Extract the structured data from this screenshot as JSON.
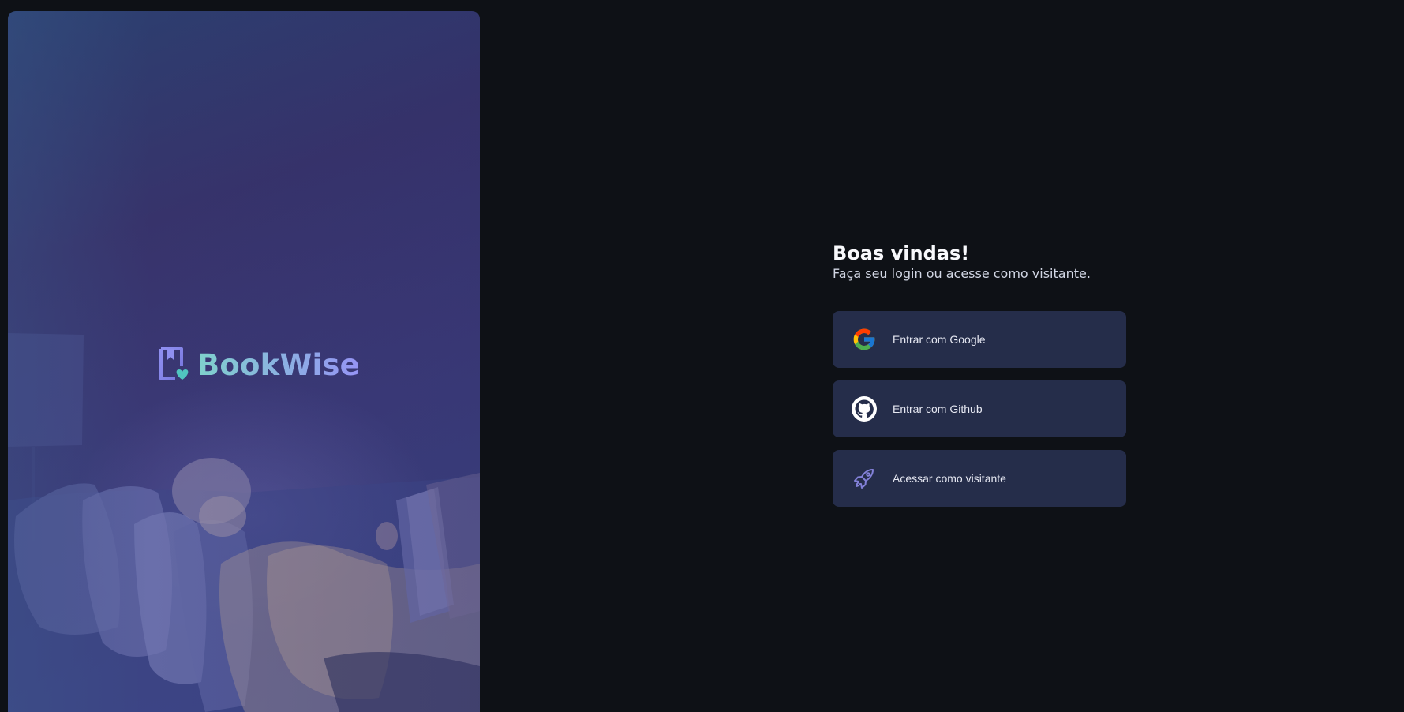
{
  "hero": {
    "brand_name": "BookWise",
    "image": "woman-reading-book-on-couch"
  },
  "login": {
    "title": "Boas vindas!",
    "subtitle": "Faça seu login ou acesse como visitante.",
    "providers": [
      {
        "label": "Entrar com Google",
        "icon": "google-icon"
      },
      {
        "label": "Entrar com Github",
        "icon": "github-icon"
      },
      {
        "label": "Acessar como visitante",
        "icon": "rocket-icon"
      }
    ]
  },
  "colors": {
    "background": "#0e1116",
    "button_bg": "#252d4a",
    "brand_gradient_start": "#7fd1cc",
    "brand_gradient_end": "#9694f5"
  }
}
